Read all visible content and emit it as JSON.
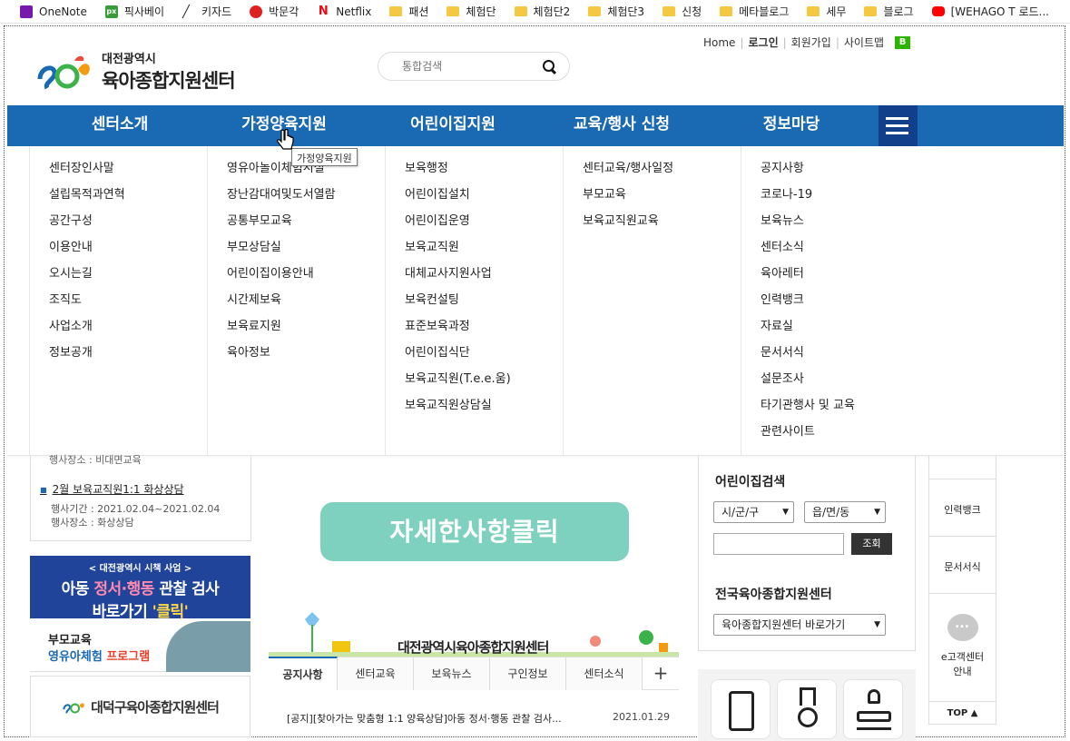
{
  "bookmarks": [
    {
      "label": "OneNote",
      "icon": "onenote-icon"
    },
    {
      "label": "픽사베이",
      "icon": "pixabay-icon"
    },
    {
      "label": "키자드",
      "icon": "wand-icon"
    },
    {
      "label": "박문각",
      "icon": "pbk-icon"
    },
    {
      "label": "Netflix",
      "icon": "netflix-icon"
    },
    {
      "label": "패션",
      "icon": "folder-icon"
    },
    {
      "label": "체험단",
      "icon": "folder-icon"
    },
    {
      "label": "체험단2",
      "icon": "folder-icon"
    },
    {
      "label": "체험단3",
      "icon": "folder-icon"
    },
    {
      "label": "신청",
      "icon": "folder-icon"
    },
    {
      "label": "메타블로그",
      "icon": "folder-icon"
    },
    {
      "label": "세무",
      "icon": "folder-icon"
    },
    {
      "label": "블로그",
      "icon": "folder-icon"
    },
    {
      "label": "[WEHAGO T 로드...",
      "icon": "youtube-icon"
    }
  ],
  "util": {
    "home": "Home",
    "login": "로그인",
    "join": "회원가입",
    "sitemap": "사이트맵",
    "blog": "B"
  },
  "logo": {
    "sub": "대전광역시",
    "main": "육아종합지원센터"
  },
  "search": {
    "placeholder": "통합검색"
  },
  "nav": [
    "센터소개",
    "가정양육지원",
    "어린이집지원",
    "교육/행사 신청",
    "정보마당"
  ],
  "tooltip": "가정양육지원",
  "menu": {
    "col1": [
      "센터장인사말",
      "설립목적과연혁",
      "공간구성",
      "이용안내",
      "오시는길",
      "조직도",
      "사업소개",
      "정보공개"
    ],
    "col2": [
      "영유아놀이체험시설",
      "장난감대여및도서열람",
      "공통부모교육",
      "부모상담실",
      "어린이집이용안내",
      "시간제보육",
      "보육료지원",
      "육아정보"
    ],
    "col3": [
      "보육행정",
      "어린이집설치",
      "어린이집운영",
      "보육교직원",
      "대체교사지원사업",
      "보육컨설팅",
      "표준보육과정",
      "어린이집식단",
      "보육교직원(T.e.e.움)",
      "보육교직원상담실"
    ],
    "col4": [
      "센터교육/행사일정",
      "부모교육",
      "보육교직원교육"
    ],
    "col5": [
      "공지사항",
      "코로나-19",
      "보육뉴스",
      "센터소식",
      "육아레터",
      "인력뱅크",
      "자료실",
      "문서서식",
      "설문조사",
      "타기관행사 및 교육",
      "관련사이트"
    ]
  },
  "event": {
    "cut_text": "행사장소 : 비대면교육",
    "title": "2월 보육교직원1:1 화상상담",
    "period": "행사기간 : 2021.02.04~2021.02.04",
    "place": "행사장소 : 화상상담"
  },
  "banner1": {
    "line1": "< 대전광역시 시책 사업 >",
    "line2a": "아동 ",
    "line2b": "정서·행동",
    "line2c": " 관찰 검사",
    "line3a": "바로가기 ",
    "line3b": "'클릭'"
  },
  "banner2": {
    "line1": "부모교육",
    "line2a": "영유아체험 ",
    "line2b": "프로그램"
  },
  "banner3": {
    "text": "대덕구육아종합지원센터"
  },
  "detail_button": "자세한사항클릭",
  "center_art_text": "대전광역시육아종합지원센터",
  "tabs": [
    "공지사항",
    "센터교육",
    "보육뉴스",
    "구인정보",
    "센터소식"
  ],
  "tab_plus": "+",
  "notice": {
    "title": "[공지][찾아가는 맞춤형 1:1 양육상담]아동 정서·행동 관찰 검사...",
    "date": "2021.01.29"
  },
  "daycare_search": {
    "title": "어린이집검색",
    "select1": "시/군/구",
    "select2": "읍/면/동",
    "button": "조회",
    "title2": "전국육아종합지원센터",
    "select3": "육아종합지원센터 바로가기"
  },
  "quick": {
    "item1": "인력뱅크",
    "item2": "문서서식",
    "item3a": "e고객센터",
    "item3b": "안내",
    "top": "TOP ▲"
  },
  "colors": {
    "nav_blue": "#1a69b3",
    "nav_menu": "#123f8a",
    "mint": "#7fd1bf"
  }
}
